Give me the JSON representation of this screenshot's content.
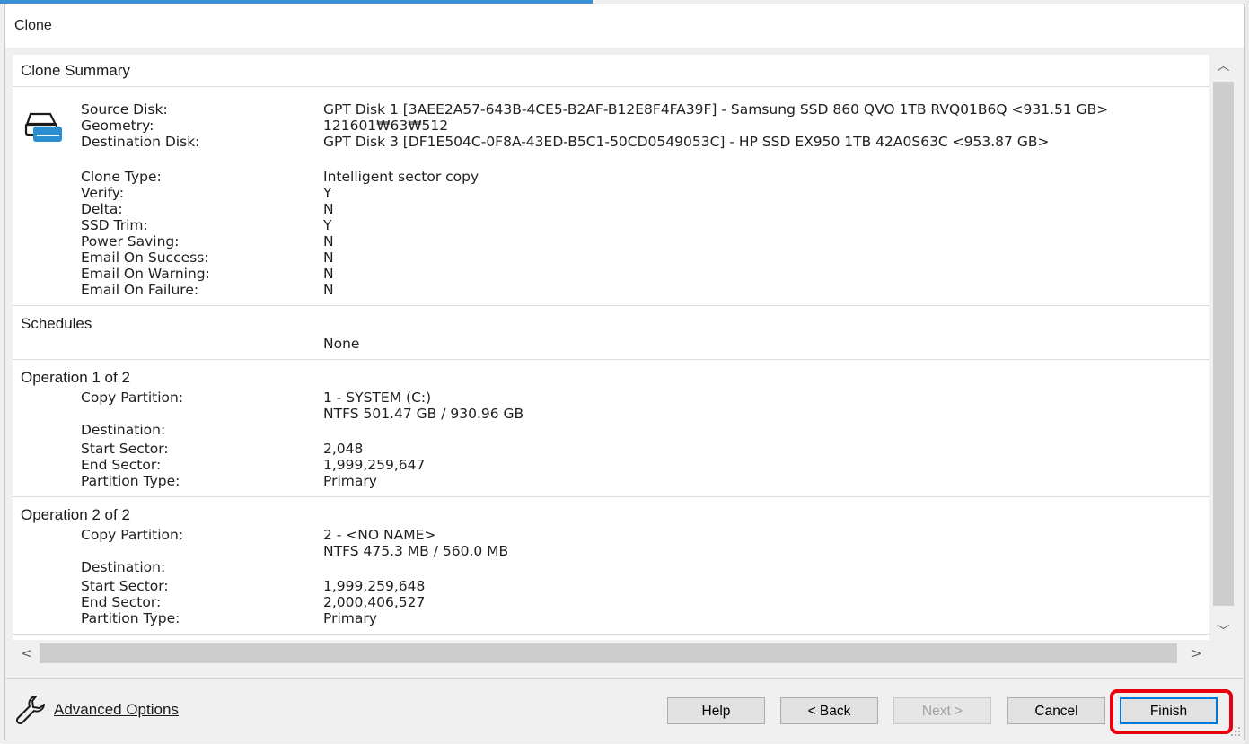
{
  "window": {
    "title": "Clone"
  },
  "summary": {
    "heading": "Clone Summary",
    "disk_rows": [
      {
        "label": "Source Disk:",
        "value": "GPT Disk 1 [3AEE2A57-643B-4CE5-B2AF-B12E8F4FA39F] - Samsung SSD 860 QVO 1TB RVQ01B6Q  <931.51 GB>"
      },
      {
        "label": "Geometry:",
        "value": "121601₩63₩512"
      },
      {
        "label": "Destination Disk:",
        "value": "GPT Disk 3 [DF1E504C-0F8A-43ED-B5C1-50CD0549053C] - HP SSD EX950 1TB 42A0S63C  <953.87 GB>"
      }
    ],
    "option_rows": [
      {
        "label": "Clone Type:",
        "value": "Intelligent sector copy"
      },
      {
        "label": "Verify:",
        "value": "Y"
      },
      {
        "label": "Delta:",
        "value": "N"
      },
      {
        "label": "SSD Trim:",
        "value": "Y"
      },
      {
        "label": "Power Saving:",
        "value": "N"
      },
      {
        "label": "Email On Success:",
        "value": "N"
      },
      {
        "label": "Email On Warning:",
        "value": "N"
      },
      {
        "label": "Email On Failure:",
        "value": "N"
      }
    ]
  },
  "schedules": {
    "heading": "Schedules",
    "value": "None"
  },
  "operations": [
    {
      "heading": "Operation 1 of 2",
      "copy_label": "Copy Partition:",
      "copy_value": "1 - SYSTEM (C:)",
      "copy_detail": "NTFS 501.47 GB / 930.96 GB",
      "dest_label": "Destination:",
      "start_label": "Start Sector:",
      "start_value": "2,048",
      "end_label": "End Sector:",
      "end_value": "1,999,259,647",
      "type_label": "Partition Type:",
      "type_value": "Primary"
    },
    {
      "heading": "Operation 2 of 2",
      "copy_label": "Copy Partition:",
      "copy_value": "2 - <NO NAME>",
      "copy_detail": "NTFS 475.3 MB / 560.0 MB",
      "dest_label": "Destination:",
      "start_label": "Start Sector:",
      "start_value": "1,999,259,648",
      "end_label": "End Sector:",
      "end_value": "2,000,406,527",
      "type_label": "Partition Type:",
      "type_value": "Primary"
    }
  ],
  "scrollbars": {
    "up": "︿",
    "down": "﹀",
    "left": "<",
    "right": ">"
  },
  "footer": {
    "advanced_label": "Advanced Options",
    "buttons": {
      "help": "Help",
      "back": "< Back",
      "next": "Next >",
      "cancel": "Cancel",
      "finish": "Finish"
    }
  },
  "colors": {
    "accent": "#0078d7",
    "highlight": "#e8000f",
    "disk_icon": "#1e88c8"
  }
}
